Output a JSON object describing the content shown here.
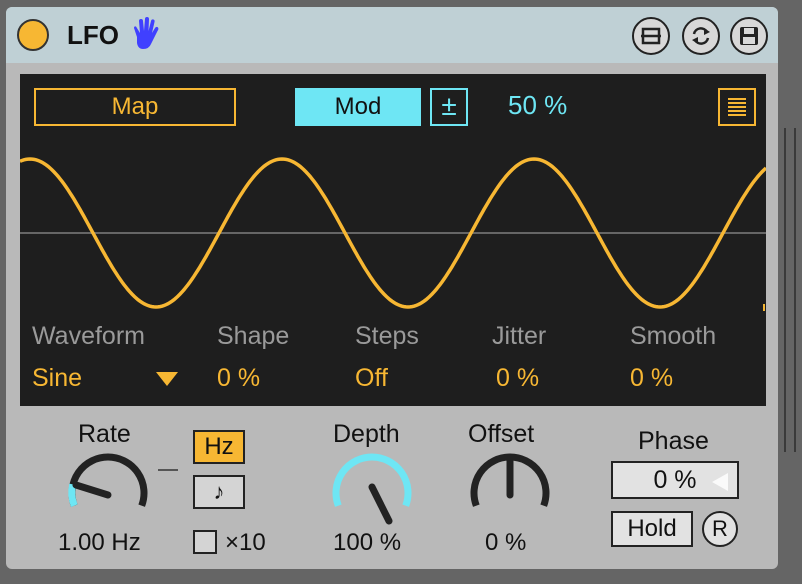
{
  "device": {
    "title": "LFO",
    "colors": {
      "accent": "#f7b733",
      "mod": "#6ee6f4",
      "display_bg": "#1e1e1e",
      "panel_bg": "#b9b9b9",
      "header_bg": "#bfd0d5"
    },
    "header_icons": [
      "power-icon",
      "hand-icon",
      "freeze-icon",
      "hot-swap-icon",
      "save-preset-icon"
    ]
  },
  "display": {
    "map_label": "Map",
    "mod_label": "Mod",
    "plusminus_label": "±",
    "mod_amount": "50 %",
    "params": [
      {
        "label": "Waveform",
        "value": "Sine"
      },
      {
        "label": "Shape",
        "value": "0 %"
      },
      {
        "label": "Steps",
        "value": "Off"
      },
      {
        "label": "Jitter",
        "value": "0 %"
      },
      {
        "label": "Smooth",
        "value": "0 %"
      }
    ],
    "waveform_cycles": 3
  },
  "controls": {
    "rate": {
      "label": "Rate",
      "value": "1.00 Hz",
      "knob_fraction": 0.3
    },
    "hz_label": "Hz",
    "note_label": "♪",
    "x10_label": "×10",
    "x10_checked": false,
    "depth": {
      "label": "Depth",
      "value": "100 %",
      "knob_fraction": 1.0
    },
    "offset": {
      "label": "Offset",
      "value": "0 %",
      "knob_fraction": 0.5
    },
    "phase": {
      "label": "Phase",
      "value": "0 %"
    },
    "hold_label": "Hold",
    "retrigger_label": "R"
  }
}
